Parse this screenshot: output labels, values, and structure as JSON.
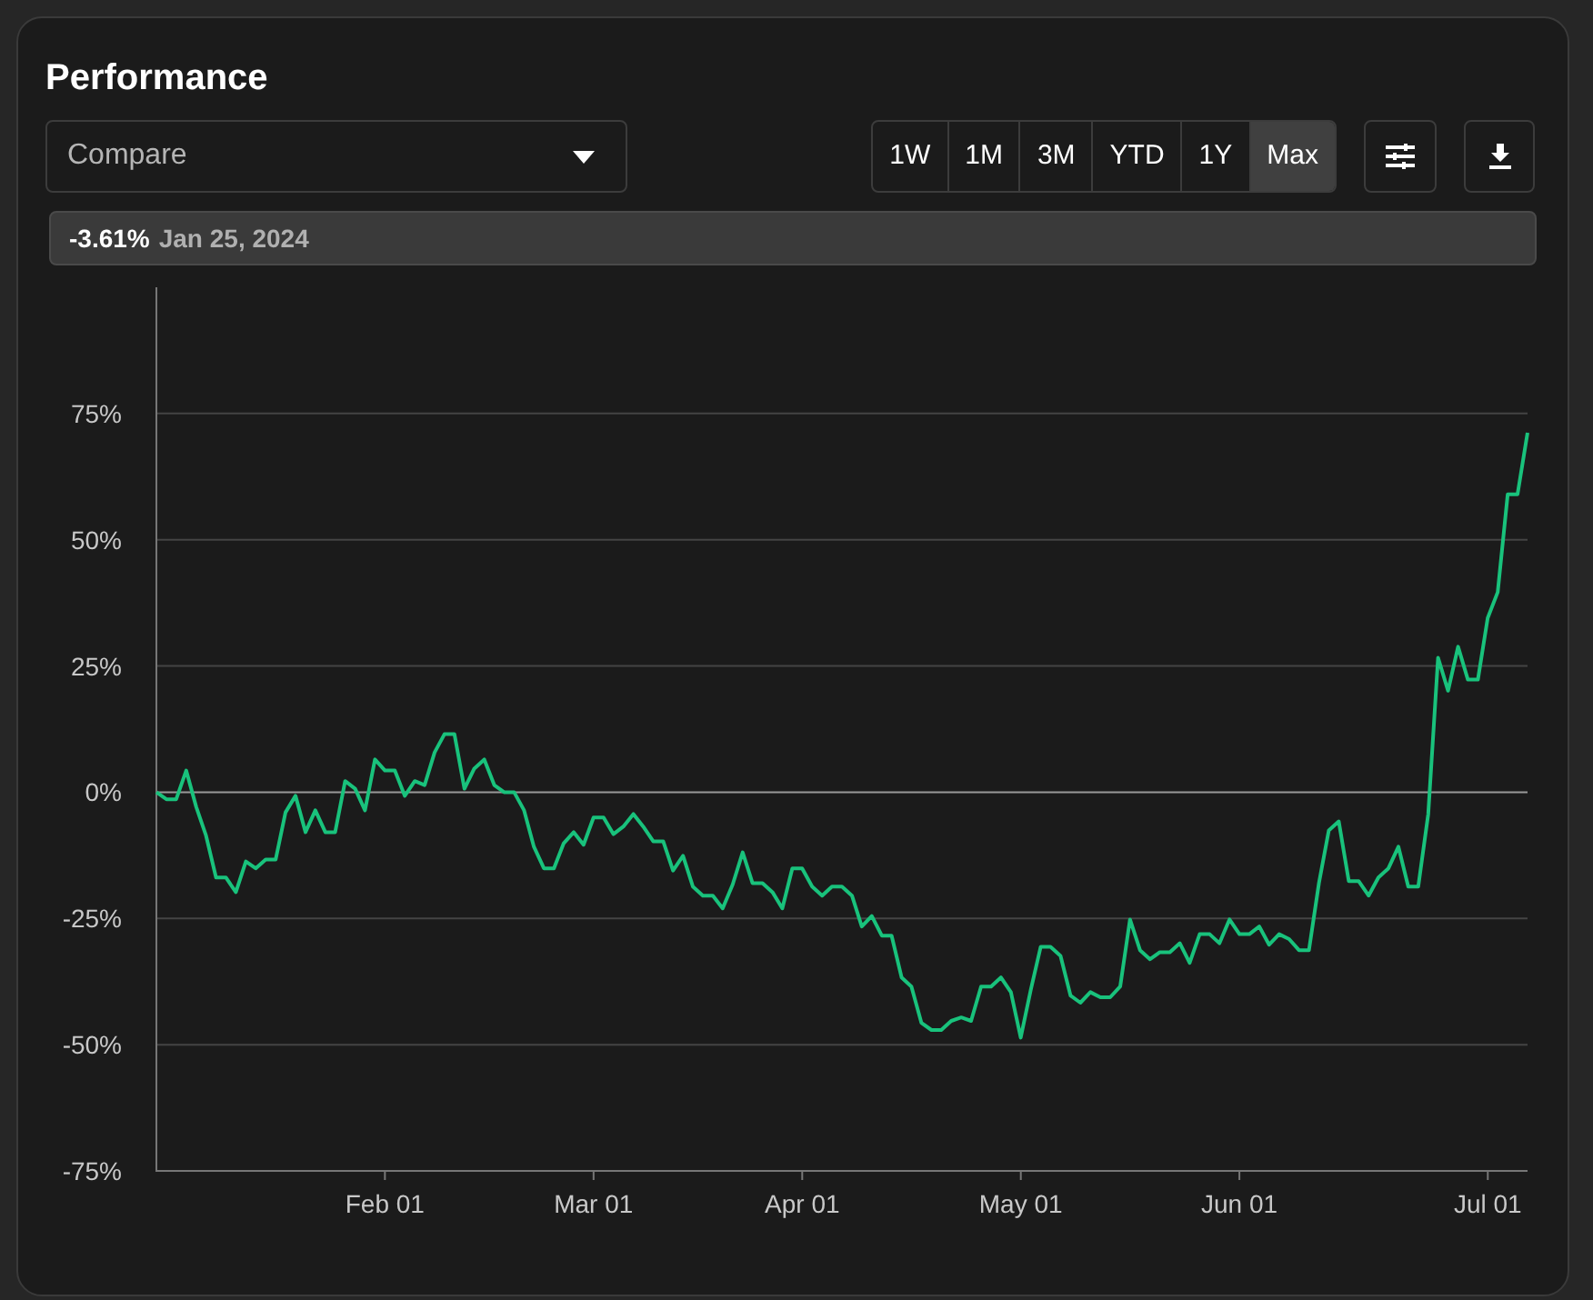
{
  "title": "Performance",
  "compare": {
    "placeholder": "Compare"
  },
  "ranges": [
    {
      "label": "1W",
      "selected": false
    },
    {
      "label": "1M",
      "selected": false
    },
    {
      "label": "3M",
      "selected": false
    },
    {
      "label": "YTD",
      "selected": false
    },
    {
      "label": "1Y",
      "selected": false
    },
    {
      "label": "Max",
      "selected": true
    }
  ],
  "tooltip": {
    "value": "-3.61%",
    "date": "Jan 25, 2024"
  },
  "chart_data": {
    "type": "line",
    "grid": true,
    "ylim": [
      -75,
      100
    ],
    "yticks": [
      {
        "value": 75,
        "label": "75%"
      },
      {
        "value": 50,
        "label": "50%"
      },
      {
        "value": 25,
        "label": "25%"
      },
      {
        "value": 0,
        "label": "0%"
      },
      {
        "value": -25,
        "label": "-25%"
      },
      {
        "value": -50,
        "label": "-50%"
      },
      {
        "value": -75,
        "label": "-75%"
      }
    ],
    "categories": [
      null,
      null,
      null,
      null,
      null,
      null,
      null,
      null,
      null,
      null,
      null,
      null,
      null,
      null,
      null,
      null,
      null,
      null,
      null,
      null,
      null,
      null,
      null,
      "Feb 01",
      null,
      null,
      null,
      null,
      null,
      null,
      null,
      null,
      null,
      null,
      null,
      null,
      null,
      null,
      null,
      null,
      null,
      null,
      null,
      null,
      "Mar 01",
      null,
      null,
      null,
      null,
      null,
      null,
      null,
      null,
      null,
      null,
      null,
      null,
      null,
      null,
      null,
      null,
      null,
      null,
      null,
      null,
      "Apr 01",
      null,
      null,
      null,
      null,
      null,
      null,
      null,
      null,
      null,
      null,
      null,
      null,
      null,
      null,
      null,
      null,
      null,
      null,
      null,
      null,
      null,
      "May 01",
      null,
      null,
      null,
      null,
      null,
      null,
      null,
      null,
      null,
      null,
      null,
      null,
      null,
      null,
      null,
      null,
      null,
      null,
      null,
      null,
      null,
      "Jun 01",
      null,
      null,
      null,
      null,
      null,
      null,
      null,
      null,
      null,
      null,
      null,
      null,
      null,
      null,
      null,
      null,
      null,
      null,
      null,
      null,
      null,
      null,
      null,
      null,
      "Jul 01",
      null,
      null,
      null,
      null
    ],
    "series": [
      {
        "color": "#19c27c",
        "values": [
          0,
          -1.4,
          -1.4,
          4.3,
          -2.9,
          -8.6,
          -16.9,
          -16.9,
          -19.8,
          -13.7,
          -15.1,
          -13.3,
          -13.3,
          -4.0,
          -0.7,
          -7.9,
          -3.6,
          -7.9,
          -7.9,
          2.2,
          0.7,
          -3.6,
          6.5,
          4.3,
          4.3,
          -0.7,
          2.2,
          1.4,
          7.9,
          11.5,
          11.5,
          0.7,
          4.7,
          6.5,
          1.4,
          0,
          0,
          -3.6,
          -10.8,
          -15.1,
          -15.1,
          -10.1,
          -7.9,
          -10.4,
          -5.0,
          -5.0,
          -8.3,
          -6.8,
          -4.3,
          -6.8,
          -9.7,
          -9.7,
          -15.5,
          -12.6,
          -18.7,
          -20.5,
          -20.5,
          -23.0,
          -18.3,
          -11.9,
          -18.0,
          -18.0,
          -19.8,
          -23.0,
          -15.1,
          -15.1,
          -18.7,
          -20.5,
          -18.7,
          -18.7,
          -20.5,
          -26.6,
          -24.5,
          -28.4,
          -28.4,
          -36.7,
          -38.5,
          -45.7,
          -47.1,
          -47.1,
          -45.3,
          -44.6,
          -45.3,
          -38.5,
          -38.5,
          -36.7,
          -39.6,
          -48.6,
          -39.2,
          -30.6,
          -30.6,
          -32.4,
          -40.3,
          -41.7,
          -39.6,
          -40.6,
          -40.6,
          -38.5,
          -25.2,
          -31.3,
          -33.1,
          -31.7,
          -31.7,
          -29.9,
          -33.8,
          -28.1,
          -28.1,
          -29.9,
          -25.2,
          -28.1,
          -28.1,
          -26.6,
          -30.2,
          -28.1,
          -29.1,
          -31.3,
          -31.3,
          -18.0,
          -7.6,
          -5.8,
          -17.6,
          -17.6,
          -20.5,
          -16.9,
          -15.1,
          -10.8,
          -18.7,
          -18.7,
          -4.3,
          26.6,
          20.1,
          28.8,
          22.3,
          22.3,
          34.5,
          39.6,
          59.0,
          59.0,
          71.2
        ]
      }
    ]
  }
}
